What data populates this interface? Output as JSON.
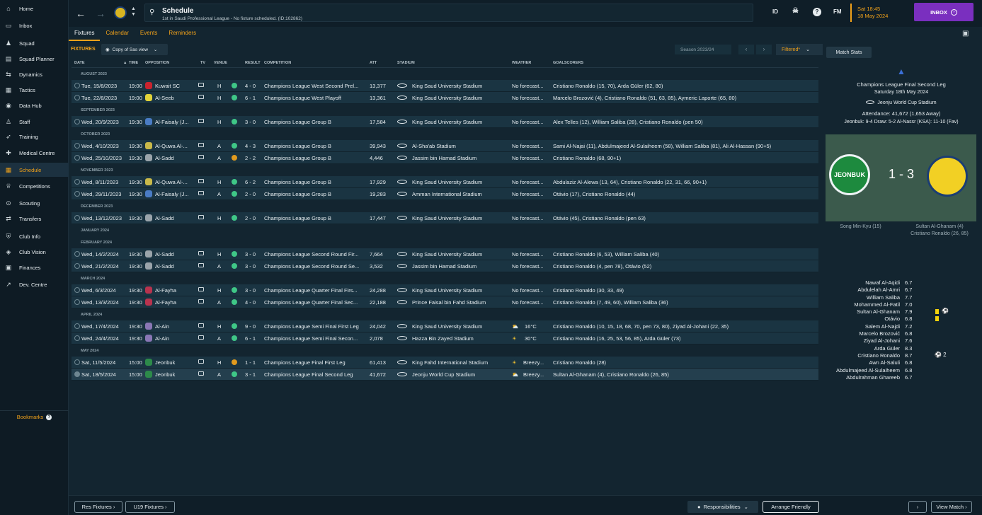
{
  "sidebar": {
    "items": [
      {
        "label": "Home",
        "icon": "home-icon",
        "active": false
      },
      {
        "label": "Inbox",
        "icon": "inbox-icon",
        "active": false
      },
      {
        "label": "Squad",
        "icon": "squad-icon",
        "active": false
      },
      {
        "label": "Squad Planner",
        "icon": "planner-icon",
        "active": false
      },
      {
        "label": "Dynamics",
        "icon": "dynamics-icon",
        "active": false
      },
      {
        "label": "Tactics",
        "icon": "tactics-icon",
        "active": false
      },
      {
        "label": "Data Hub",
        "icon": "data-hub-icon",
        "active": false
      },
      {
        "label": "Staff",
        "icon": "staff-icon",
        "active": false
      },
      {
        "label": "Training",
        "icon": "training-icon",
        "active": false
      },
      {
        "label": "Medical Centre",
        "icon": "medical-icon",
        "active": false
      },
      {
        "label": "Schedule",
        "icon": "calendar-icon",
        "active": true
      },
      {
        "label": "Competitions",
        "icon": "trophy-icon",
        "active": false
      },
      {
        "label": "Scouting",
        "icon": "scouting-icon",
        "active": false
      },
      {
        "label": "Transfers",
        "icon": "transfers-icon",
        "active": false
      },
      {
        "label": "Club Info",
        "icon": "shield-icon",
        "active": false
      },
      {
        "label": "Club Vision",
        "icon": "vision-icon",
        "active": false
      },
      {
        "label": "Finances",
        "icon": "finances-icon",
        "active": false
      },
      {
        "label": "Dev. Centre",
        "icon": "dev-icon",
        "active": false
      }
    ],
    "bookmarks": "Bookmarks"
  },
  "topbar": {
    "title": "Schedule",
    "subtitle": "1st in Saudi Professional League - No fixture scheduled. (ID:102862)",
    "id_label": "ID",
    "fm_label": "FM",
    "time": "Sat 18:45",
    "date": "18 May 2024",
    "inbox": "INBOX"
  },
  "tabs": [
    "Fixtures",
    "Calendar",
    "Events",
    "Reminders"
  ],
  "toolbar": {
    "fixtures_label": "FIXTURES",
    "view": "Copy of Sas view",
    "season": "Season 2023/24",
    "filter": "Filtered*",
    "match_stats": "Match Stats"
  },
  "headers": {
    "date": "DATE",
    "time": "TIME",
    "opposition": "OPPOSITION",
    "tv": "TV",
    "venue": "VENUE",
    "result": "RESULT",
    "competition": "COMPETITION",
    "att": "ATT",
    "stadium": "STADIUM",
    "weather": "WEATHER",
    "goalscorers": "GOALSCORERS"
  },
  "schedule": [
    {
      "month": "AUGUST 2023",
      "fixtures": [
        {
          "date": "Tue, 15/8/2023",
          "time": "19:00",
          "opp": "Kuwait SC",
          "crest": "#c9232e",
          "venue": "H",
          "outcome": "win",
          "result": "4 - 0",
          "comp": "Champions League West Second Prel...",
          "att": "13,377",
          "stadium": "King Saud University Stadium",
          "weather": "No forecast...",
          "weather_icon": "",
          "temp": "",
          "scorers": "Cristiano Ronaldo (15, 70), Arda Güler (62, 80)"
        },
        {
          "date": "Tue, 22/8/2023",
          "time": "19:00",
          "opp": "Al-Seeb",
          "crest": "#e2d33a",
          "venue": "H",
          "outcome": "win",
          "result": "6 - 1",
          "comp": "Champions League West Playoff",
          "att": "13,361",
          "stadium": "King Saud University Stadium",
          "weather": "No forecast...",
          "weather_icon": "",
          "temp": "",
          "scorers": "Marcelo Brozović (4), Cristiano Ronaldo (51, 63, 85), Aymeric Laporte (65, 80)"
        }
      ]
    },
    {
      "month": "SEPTEMBER 2023",
      "fixtures": [
        {
          "date": "Wed, 20/9/2023",
          "time": "19:30",
          "opp": "Al-Faisaly (J...",
          "crest": "#4a7cc4",
          "venue": "H",
          "outcome": "win",
          "result": "3 - 0",
          "comp": "Champions League Group B",
          "att": "17,584",
          "stadium": "King Saud University Stadium",
          "weather": "No forecast...",
          "weather_icon": "",
          "temp": "",
          "scorers": "Alex Telles (12), William Saliba (28), Cristiano Ronaldo (pen 50)"
        }
      ]
    },
    {
      "month": "OCTOBER 2023",
      "fixtures": [
        {
          "date": "Wed, 4/10/2023",
          "time": "19:30",
          "opp": "Al-Quwa Al-...",
          "crest": "#c9b94a",
          "venue": "A",
          "outcome": "win",
          "result": "4 - 3",
          "comp": "Champions League Group B",
          "att": "39,943",
          "stadium": "Al-Sha'ab Stadium",
          "weather": "No forecast...",
          "weather_icon": "",
          "temp": "",
          "scorers": "Sami Al-Najai (11), Abdulmajeed Al-Sulaiheem (58), William Saliba (81), Ali Al-Hassan (90+5)"
        },
        {
          "date": "Wed, 25/10/2023",
          "time": "19:30",
          "opp": "Al-Sadd",
          "crest": "#9aa4ab",
          "venue": "A",
          "outcome": "draw",
          "result": "2 - 2",
          "comp": "Champions League Group B",
          "att": "4,446",
          "stadium": "Jassim bin Hamad Stadium",
          "weather": "No forecast...",
          "weather_icon": "",
          "temp": "",
          "scorers": "Cristiano Ronaldo (68, 90+1)"
        }
      ]
    },
    {
      "month": "NOVEMBER 2023",
      "fixtures": [
        {
          "date": "Wed, 8/11/2023",
          "time": "19:30",
          "opp": "Al-Quwa Al-...",
          "crest": "#c9b94a",
          "venue": "H",
          "outcome": "win",
          "result": "6 - 2",
          "comp": "Champions League Group B",
          "att": "17,929",
          "stadium": "King Saud University Stadium",
          "weather": "No forecast...",
          "weather_icon": "",
          "temp": "",
          "scorers": "Abdulaziz Al-Alewa (13, 64), Cristiano Ronaldo (22, 31, 66, 90+1)"
        },
        {
          "date": "Wed, 29/11/2023",
          "time": "19:30",
          "opp": "Al-Faisaly (J...",
          "crest": "#4a7cc4",
          "venue": "A",
          "outcome": "win",
          "result": "2 - 0",
          "comp": "Champions League Group B",
          "att": "19,283",
          "stadium": "Amman International Stadium",
          "weather": "No forecast...",
          "weather_icon": "",
          "temp": "",
          "scorers": "Otávio (17), Cristiano Ronaldo (44)"
        }
      ]
    },
    {
      "month": "DECEMBER 2023",
      "fixtures": [
        {
          "date": "Wed, 13/12/2023",
          "time": "19:30",
          "opp": "Al-Sadd",
          "crest": "#9aa4ab",
          "venue": "H",
          "outcome": "win",
          "result": "2 - 0",
          "comp": "Champions League Group B",
          "att": "17,447",
          "stadium": "King Saud University Stadium",
          "weather": "No forecast...",
          "weather_icon": "",
          "temp": "",
          "scorers": "Otávio (45), Cristiano Ronaldo (pen 63)"
        }
      ]
    },
    {
      "month": "JANUARY 2024",
      "fixtures": []
    },
    {
      "month": "FEBRUARY 2024",
      "fixtures": [
        {
          "date": "Wed, 14/2/2024",
          "time": "19:30",
          "opp": "Al-Sadd",
          "crest": "#9aa4ab",
          "venue": "H",
          "outcome": "win",
          "result": "3 - 0",
          "comp": "Champions League Second Round Fir...",
          "att": "7,664",
          "stadium": "King Saud University Stadium",
          "weather": "No forecast...",
          "weather_icon": "",
          "temp": "",
          "scorers": "Cristiano Ronaldo (6, 53), William Saliba (40)"
        },
        {
          "date": "Wed, 21/2/2024",
          "time": "19:30",
          "opp": "Al-Sadd",
          "crest": "#9aa4ab",
          "venue": "A",
          "outcome": "win",
          "result": "3 - 0",
          "comp": "Champions League Second Round Se...",
          "att": "3,532",
          "stadium": "Jassim bin Hamad Stadium",
          "weather": "No forecast...",
          "weather_icon": "",
          "temp": "",
          "scorers": "Cristiano Ronaldo (4, pen 78), Otávio (52)"
        }
      ]
    },
    {
      "month": "MARCH 2024",
      "fixtures": [
        {
          "date": "Wed, 6/3/2024",
          "time": "19:30",
          "opp": "Al-Fayha",
          "crest": "#b8334e",
          "venue": "H",
          "outcome": "win",
          "result": "3 - 0",
          "comp": "Champions League Quarter Final Firs...",
          "att": "24,288",
          "stadium": "King Saud University Stadium",
          "weather": "No forecast...",
          "weather_icon": "",
          "temp": "",
          "scorers": "Cristiano Ronaldo (30, 33, 49)"
        },
        {
          "date": "Wed, 13/3/2024",
          "time": "19:30",
          "opp": "Al-Fayha",
          "crest": "#b8334e",
          "venue": "A",
          "outcome": "win",
          "result": "4 - 0",
          "comp": "Champions League Quarter Final Sec...",
          "att": "22,188",
          "stadium": "Prince Faisal bin Fahd Stadium",
          "weather": "No forecast...",
          "weather_icon": "",
          "temp": "",
          "scorers": "Cristiano Ronaldo (7, 49, 60), William Saliba (36)"
        }
      ]
    },
    {
      "month": "APRIL 2024",
      "fixtures": [
        {
          "date": "Wed, 17/4/2024",
          "time": "19:30",
          "opp": "Al-Ain",
          "crest": "#8a77b5",
          "venue": "H",
          "outcome": "win",
          "result": "9 - 0",
          "comp": "Champions League Semi Final First Leg",
          "att": "24,042",
          "stadium": "King Saud University Stadium",
          "weather": "",
          "weather_icon": "cloud-sun",
          "temp": "16°C",
          "scorers": "Cristiano Ronaldo (10, 15, 18, 68, 70, pen 73, 80), Ziyad Al-Johani (22, 35)"
        },
        {
          "date": "Wed, 24/4/2024",
          "time": "19:30",
          "opp": "Al-Ain",
          "crest": "#8a77b5",
          "venue": "A",
          "outcome": "win",
          "result": "6 - 1",
          "comp": "Champions League Semi Final Secon...",
          "att": "2,078",
          "stadium": "Hazza Bin Zayed Stadium",
          "weather": "",
          "weather_icon": "sun",
          "temp": "30°C",
          "scorers": "Cristiano Ronaldo (16, 25, 53, 56, 85), Arda Güler (73)"
        }
      ]
    },
    {
      "month": "MAY 2024",
      "fixtures": [
        {
          "date": "Sat, 11/5/2024",
          "time": "15:00",
          "opp": "Jeonbuk",
          "crest": "#2d8a4a",
          "venue": "H",
          "outcome": "draw",
          "result": "1 - 1",
          "comp": "Champions League Final First Leg",
          "att": "61,413",
          "stadium": "King Fahd International Stadium",
          "weather": "Breezy...",
          "weather_icon": "sun",
          "temp": "",
          "scorers": "Cristiano Ronaldo (28)"
        },
        {
          "date": "Sat, 18/5/2024",
          "time": "15:00",
          "opp": "Jeonbuk",
          "crest": "#2d8a4a",
          "venue": "A",
          "outcome": "win",
          "result": "3 - 1",
          "comp": "Champions League Final Second Leg",
          "att": "41,672",
          "stadium": "Jeonju World Cup Stadium",
          "weather": "Breezy...",
          "weather_icon": "cloud-sun",
          "temp": "",
          "scorers": "Sultan Al-Ghanam (4), Cristiano Ronaldo (26, 85)",
          "selected": true
        }
      ]
    }
  ],
  "colors": {
    "win": "#3fc787",
    "draw": "#e09a1e",
    "accent": "#f0a11a"
  },
  "match": {
    "competition": "Champions League Final Second Leg",
    "date": "Saturday 18th May 2024",
    "stadium": "Jeonju World Cup Stadium",
    "attendance": "Attendance: 41,672 (1,653 Away)",
    "record": "Jeonbuk: 9-4 Draw: 5-2 Al-Nassr (KSA): 11-10 (Fav)",
    "home_badge": "JEONBUK",
    "score": "1 - 3",
    "home_scorers": "Song Min-Kyu (15)",
    "away_scorers_1": "Sultan Al-Ghanam (4)",
    "away_scorers_2": "Cristiano Ronaldo (26, 85)"
  },
  "ratings": [
    {
      "name": "Nawaf Al-Aqidi",
      "rating": "6.7",
      "yellow": false,
      "goals": ""
    },
    {
      "name": "Abdulelah Al-Amri",
      "rating": "6.7",
      "yellow": false,
      "goals": ""
    },
    {
      "name": "William Saliba",
      "rating": "7.7",
      "yellow": false,
      "goals": ""
    },
    {
      "name": "Mohammed Al-Fatil",
      "rating": "7.0",
      "yellow": false,
      "goals": ""
    },
    {
      "name": "Sultan Al-Ghanam",
      "rating": "7.9",
      "yellow": true,
      "goals": "⚽"
    },
    {
      "name": "Otávio",
      "rating": "6.8",
      "yellow": true,
      "goals": ""
    },
    {
      "name": "Salem Al-Najdi",
      "rating": "7.2",
      "yellow": false,
      "goals": ""
    },
    {
      "name": "Marcelo Brozović",
      "rating": "6.8",
      "yellow": false,
      "goals": ""
    },
    {
      "name": "Ziyad Al-Johani",
      "rating": "7.6",
      "yellow": false,
      "goals": ""
    },
    {
      "name": "Arda Güler",
      "rating": "8.3",
      "yellow": false,
      "goals": ""
    },
    {
      "name": "Cristiano Ronaldo",
      "rating": "8.7",
      "yellow": false,
      "goals": "⚽ 2"
    },
    {
      "name": "Awn Al-Saluli",
      "rating": "6.8",
      "yellow": false,
      "goals": ""
    },
    {
      "name": "Abdulmajeed Al-Sulaiheem",
      "rating": "6.8",
      "yellow": false,
      "goals": ""
    },
    {
      "name": "Abdulrahman Ghareeb",
      "rating": "6.7",
      "yellow": false,
      "goals": ""
    }
  ],
  "bottom": {
    "res_fixtures": "Res Fixtures ›",
    "u19_fixtures": "U19 Fixtures ›",
    "responsibilities": "Responsibilities",
    "arrange_friendly": "Arrange Friendly",
    "next": "›",
    "view_match": "View Match ›"
  }
}
